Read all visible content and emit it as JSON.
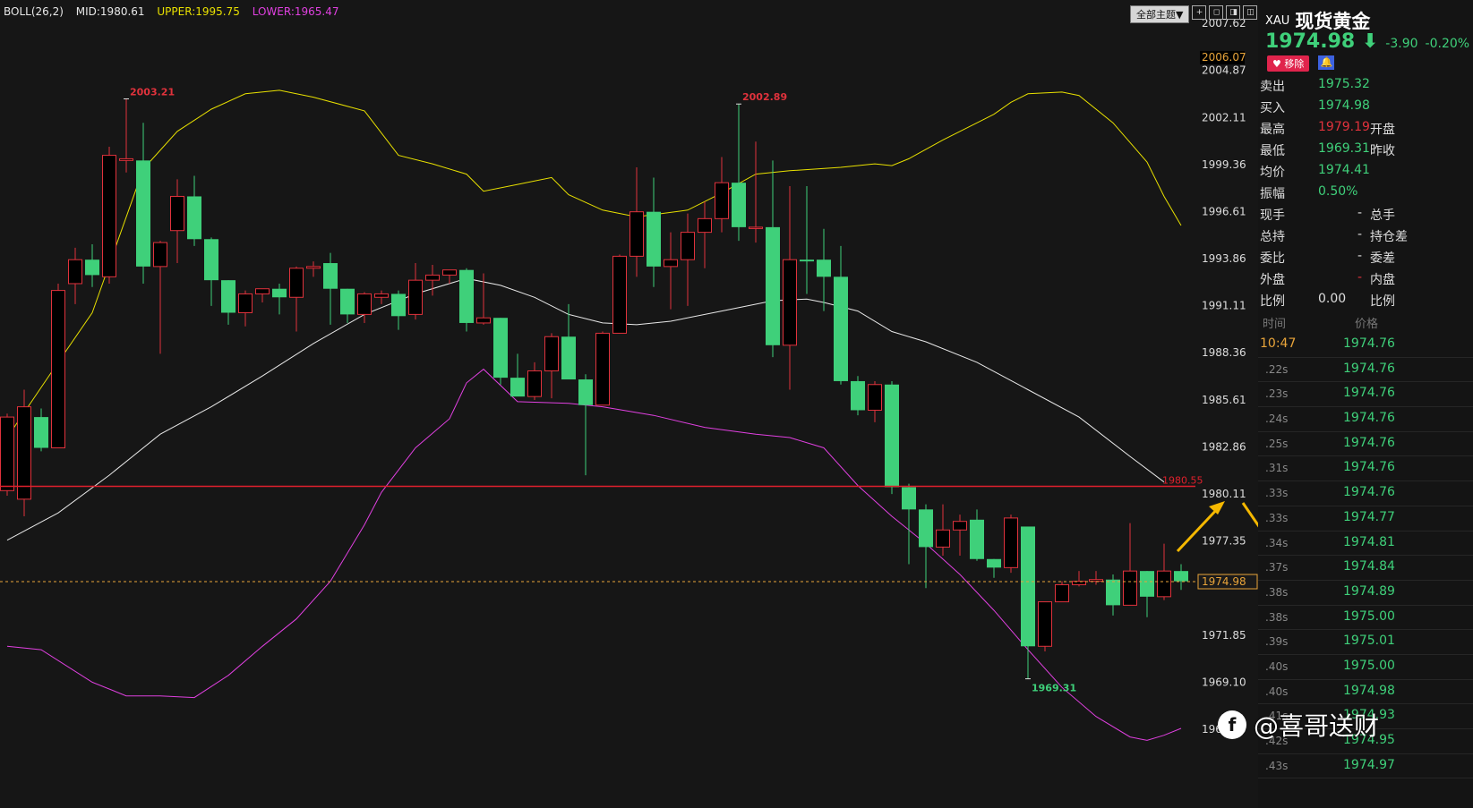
{
  "indicator": {
    "name": "BOLL(26,2)",
    "mid": "MID:1980.61",
    "upper": "UPPER:1995.75",
    "lower": "LOWER:1965.47",
    "colors": {
      "mid": "#e8e8e8",
      "upper": "#e8e000",
      "lower": "#e040e0"
    }
  },
  "toolbar": {
    "theme_label": "全部主题▼",
    "buttons": [
      "+",
      "◻",
      "◨",
      "◫"
    ]
  },
  "chart_data": {
    "type": "candlestick",
    "y_axis_labels": [
      "2007.62",
      "2004.87",
      "2002.11",
      "1999.36",
      "1996.61",
      "1993.86",
      "1991.11",
      "1988.36",
      "1985.61",
      "1982.86",
      "1980.11",
      "1977.35",
      "1971.85",
      "1969.10",
      "1966.35"
    ],
    "ylim": [
      1965.0,
      2008.9
    ],
    "high_label": "2006.07",
    "annotations": {
      "high1": "2003.21",
      "high2": "2002.89",
      "low": "1969.31"
    },
    "alert_line": {
      "value": 1980.55,
      "label": "1980.55",
      "color": "#e0202c"
    },
    "last_price": {
      "value": 1974.98,
      "label": "1974.98",
      "color": "#e8a43a"
    },
    "up_color": "#e0323c",
    "down_color": "#3fd07a",
    "candles": [
      {
        "o": 1980.3,
        "h": 1984.8,
        "l": 1980.0,
        "c": 1984.6
      },
      {
        "o": 1979.8,
        "h": 1986.2,
        "l": 1978.8,
        "c": 1985.2
      },
      {
        "o": 1984.6,
        "h": 1985.1,
        "l": 1982.6,
        "c": 1982.8
      },
      {
        "o": 1982.8,
        "h": 1992.4,
        "l": 1983.4,
        "c": 1992.0
      },
      {
        "o": 1992.4,
        "h": 1994.5,
        "l": 1991.2,
        "c": 1993.8
      },
      {
        "o": 1993.8,
        "h": 1994.7,
        "l": 1992.2,
        "c": 1992.9
      },
      {
        "o": 1992.8,
        "h": 2000.4,
        "l": 1992.4,
        "c": 1999.9
      },
      {
        "o": 1999.6,
        "h": 2003.2,
        "l": 1998.9,
        "c": 1999.7
      },
      {
        "o": 1999.6,
        "h": 2001.8,
        "l": 1992.4,
        "c": 1993.4
      },
      {
        "o": 1993.4,
        "h": 1994.9,
        "l": 1988.3,
        "c": 1994.8
      },
      {
        "o": 1995.5,
        "h": 1998.5,
        "l": 1993.6,
        "c": 1997.5
      },
      {
        "o": 1997.5,
        "h": 1998.7,
        "l": 1994.6,
        "c": 1995.0
      },
      {
        "o": 1995.0,
        "h": 1995.1,
        "l": 1991.1,
        "c": 1992.6
      },
      {
        "o": 1992.6,
        "h": 1992.6,
        "l": 1990.0,
        "c": 1990.7
      },
      {
        "o": 1990.7,
        "h": 1992.0,
        "l": 1989.9,
        "c": 1991.8
      },
      {
        "o": 1991.8,
        "h": 1992.1,
        "l": 1991.3,
        "c": 1992.1
      },
      {
        "o": 1992.1,
        "h": 1992.4,
        "l": 1990.6,
        "c": 1991.6
      },
      {
        "o": 1991.6,
        "h": 1993.4,
        "l": 1989.6,
        "c": 1993.3
      },
      {
        "o": 1993.3,
        "h": 1993.7,
        "l": 1992.8,
        "c": 1993.4
      },
      {
        "o": 1993.6,
        "h": 1994.2,
        "l": 1990.0,
        "c": 1992.1
      },
      {
        "o": 1992.1,
        "h": 1992.1,
        "l": 1990.1,
        "c": 1990.6
      },
      {
        "o": 1990.6,
        "h": 1991.9,
        "l": 1990.1,
        "c": 1991.8
      },
      {
        "o": 1991.6,
        "h": 1992.0,
        "l": 1991.2,
        "c": 1991.8
      },
      {
        "o": 1991.8,
        "h": 1992.0,
        "l": 1989.7,
        "c": 1990.5
      },
      {
        "o": 1990.6,
        "h": 1993.6,
        "l": 1990.3,
        "c": 1992.6
      },
      {
        "o": 1992.6,
        "h": 1993.5,
        "l": 1991.7,
        "c": 1992.9
      },
      {
        "o": 1992.9,
        "h": 1993.2,
        "l": 1992.4,
        "c": 1993.2
      },
      {
        "o": 1993.2,
        "h": 1993.3,
        "l": 1989.6,
        "c": 1990.1
      },
      {
        "o": 1990.1,
        "h": 1993.0,
        "l": 1990.0,
        "c": 1990.4
      },
      {
        "o": 1990.4,
        "h": 1990.4,
        "l": 1986.5,
        "c": 1986.9
      },
      {
        "o": 1986.9,
        "h": 1988.3,
        "l": 1985.9,
        "c": 1985.8
      },
      {
        "o": 1985.8,
        "h": 1987.8,
        "l": 1985.6,
        "c": 1987.3
      },
      {
        "o": 1987.3,
        "h": 1989.5,
        "l": 1985.7,
        "c": 1989.3
      },
      {
        "o": 1989.3,
        "h": 1991.2,
        "l": 1986.8,
        "c": 1986.8
      },
      {
        "o": 1986.8,
        "h": 1987.1,
        "l": 1981.2,
        "c": 1985.3
      },
      {
        "o": 1985.3,
        "h": 1989.6,
        "l": 1985.4,
        "c": 1989.5
      },
      {
        "o": 1989.5,
        "h": 1994.1,
        "l": 1989.6,
        "c": 1994.0
      },
      {
        "o": 1994.0,
        "h": 1999.2,
        "l": 1992.8,
        "c": 1996.6
      },
      {
        "o": 1996.6,
        "h": 1998.6,
        "l": 1992.2,
        "c": 1993.4
      },
      {
        "o": 1993.4,
        "h": 1995.4,
        "l": 1990.9,
        "c": 1993.8
      },
      {
        "o": 1993.8,
        "h": 1996.5,
        "l": 1991.1,
        "c": 1995.4
      },
      {
        "o": 1995.4,
        "h": 1997.2,
        "l": 1993.3,
        "c": 1996.2
      },
      {
        "o": 1996.2,
        "h": 1999.8,
        "l": 1995.4,
        "c": 1998.3
      },
      {
        "o": 1998.3,
        "h": 2002.9,
        "l": 1994.9,
        "c": 1995.7
      },
      {
        "o": 1995.7,
        "h": 2000.7,
        "l": 1994.8,
        "c": 1995.7
      },
      {
        "o": 1995.7,
        "h": 1999.6,
        "l": 1988.1,
        "c": 1988.8
      },
      {
        "o": 1988.8,
        "h": 1998.1,
        "l": 1986.2,
        "c": 1993.8
      },
      {
        "o": 1993.8,
        "h": 1998.1,
        "l": 1991.8,
        "c": 1993.7
      },
      {
        "o": 1993.8,
        "h": 1995.6,
        "l": 1990.8,
        "c": 1992.8
      },
      {
        "o": 1992.8,
        "h": 1994.6,
        "l": 1986.5,
        "c": 1986.7
      },
      {
        "o": 1986.7,
        "h": 1987.0,
        "l": 1984.7,
        "c": 1985.0
      },
      {
        "o": 1985.0,
        "h": 1986.7,
        "l": 1984.3,
        "c": 1986.5
      },
      {
        "o": 1986.5,
        "h": 1986.7,
        "l": 1980.1,
        "c": 1980.5
      },
      {
        "o": 1980.5,
        "h": 1980.7,
        "l": 1976.0,
        "c": 1979.2
      },
      {
        "o": 1979.2,
        "h": 1979.5,
        "l": 1974.6,
        "c": 1977.0
      },
      {
        "o": 1977.0,
        "h": 1979.5,
        "l": 1976.5,
        "c": 1978.0
      },
      {
        "o": 1978.0,
        "h": 1978.9,
        "l": 1976.5,
        "c": 1978.5
      },
      {
        "o": 1978.6,
        "h": 1979.2,
        "l": 1976.2,
        "c": 1976.3
      },
      {
        "o": 1976.3,
        "h": 1976.3,
        "l": 1975.2,
        "c": 1975.8
      },
      {
        "o": 1975.8,
        "h": 1978.9,
        "l": 1975.5,
        "c": 1978.7
      },
      {
        "o": 1978.2,
        "h": 1978.2,
        "l": 1969.3,
        "c": 1971.2
      },
      {
        "o": 1971.2,
        "h": 1973.8,
        "l": 1970.9,
        "c": 1973.8
      },
      {
        "o": 1973.8,
        "h": 1975.0,
        "l": 1973.8,
        "c": 1974.8
      },
      {
        "o": 1974.8,
        "h": 1975.6,
        "l": 1974.7,
        "c": 1975.0
      },
      {
        "o": 1975.0,
        "h": 1975.6,
        "l": 1974.8,
        "c": 1975.1
      },
      {
        "o": 1975.1,
        "h": 1975.4,
        "l": 1973.0,
        "c": 1973.6
      },
      {
        "o": 1973.6,
        "h": 1978.4,
        "l": 1973.6,
        "c": 1975.6
      },
      {
        "o": 1975.6,
        "h": 1975.6,
        "l": 1972.9,
        "c": 1974.1
      },
      {
        "o": 1974.1,
        "h": 1977.2,
        "l": 1973.9,
        "c": 1975.6
      },
      {
        "o": 1975.6,
        "h": 1976.0,
        "l": 1974.5,
        "c": 1975.0
      }
    ],
    "boll_upper": [
      [
        0,
        1983.4
      ],
      [
        3,
        1987.8
      ],
      [
        5,
        1990.7
      ],
      [
        8,
        1999.1
      ],
      [
        10,
        2001.3
      ],
      [
        12,
        2002.6
      ],
      [
        14,
        2003.5
      ],
      [
        16,
        2003.7
      ],
      [
        18,
        2003.3
      ],
      [
        21,
        2002.5
      ],
      [
        23,
        1999.9
      ],
      [
        25,
        1999.4
      ],
      [
        27,
        1998.8
      ],
      [
        28,
        1997.8
      ],
      [
        30,
        1998.2
      ],
      [
        32,
        1998.6
      ],
      [
        33,
        1997.6
      ],
      [
        35,
        1996.7
      ],
      [
        37,
        1996.3
      ],
      [
        40,
        1996.7
      ],
      [
        42,
        1997.7
      ],
      [
        44,
        1998.8
      ],
      [
        46,
        1999.0
      ],
      [
        49,
        1999.2
      ],
      [
        51,
        1999.4
      ],
      [
        52,
        1999.3
      ],
      [
        53,
        1999.7
      ],
      [
        55,
        2000.8
      ],
      [
        57,
        2001.8
      ],
      [
        58,
        2002.3
      ],
      [
        59,
        2003.0
      ],
      [
        60,
        2003.5
      ],
      [
        62,
        2003.6
      ],
      [
        63,
        2003.4
      ],
      [
        65,
        2001.8
      ],
      [
        67,
        1999.5
      ],
      [
        68,
        1997.5
      ],
      [
        69,
        1995.8
      ]
    ],
    "boll_mid": [
      [
        0,
        1977.4
      ],
      [
        3,
        1979.0
      ],
      [
        6,
        1981.2
      ],
      [
        9,
        1983.6
      ],
      [
        12,
        1985.2
      ],
      [
        15,
        1987.0
      ],
      [
        18,
        1988.9
      ],
      [
        21,
        1990.6
      ],
      [
        24,
        1991.8
      ],
      [
        27,
        1992.7
      ],
      [
        29,
        1992.3
      ],
      [
        31,
        1991.6
      ],
      [
        33,
        1990.6
      ],
      [
        35,
        1990.1
      ],
      [
        37,
        1990.0
      ],
      [
        39,
        1990.2
      ],
      [
        42,
        1990.8
      ],
      [
        45,
        1991.4
      ],
      [
        47,
        1991.5
      ],
      [
        48,
        1991.3
      ],
      [
        50,
        1990.8
      ],
      [
        52,
        1989.6
      ],
      [
        54,
        1989.0
      ],
      [
        57,
        1987.8
      ],
      [
        60,
        1986.2
      ],
      [
        63,
        1984.6
      ],
      [
        66,
        1982.3
      ],
      [
        68,
        1980.8
      ]
    ],
    "boll_lower": [
      [
        0,
        1971.2
      ],
      [
        2,
        1971.0
      ],
      [
        5,
        1969.1
      ],
      [
        7,
        1968.3
      ],
      [
        9,
        1968.3
      ],
      [
        11,
        1968.2
      ],
      [
        13,
        1969.5
      ],
      [
        15,
        1971.2
      ],
      [
        17,
        1972.8
      ],
      [
        19,
        1975.0
      ],
      [
        21,
        1978.3
      ],
      [
        22,
        1980.2
      ],
      [
        24,
        1982.8
      ],
      [
        26,
        1984.5
      ],
      [
        27,
        1986.6
      ],
      [
        28,
        1987.4
      ],
      [
        30,
        1985.5
      ],
      [
        33,
        1985.4
      ],
      [
        35,
        1985.2
      ],
      [
        38,
        1984.7
      ],
      [
        41,
        1984.0
      ],
      [
        44,
        1983.6
      ],
      [
        46,
        1983.4
      ],
      [
        48,
        1982.8
      ],
      [
        50,
        1980.6
      ],
      [
        52,
        1978.8
      ],
      [
        54,
        1977.2
      ],
      [
        56,
        1975.4
      ],
      [
        58,
        1973.3
      ],
      [
        60,
        1971.0
      ],
      [
        62,
        1968.8
      ],
      [
        64,
        1967.1
      ],
      [
        66,
        1965.9
      ],
      [
        67,
        1965.7
      ],
      [
        68,
        1966.0
      ],
      [
        69,
        1966.4
      ]
    ]
  },
  "panel": {
    "symbol_code": "XAU",
    "symbol_name": "现货黄金",
    "price": "1974.98 ⬇",
    "change": "-3.90",
    "change_pct": "-0.20%",
    "remove_label": "♥ 移除",
    "bell": "🔔",
    "quotes": [
      {
        "label": "卖出",
        "value": "1975.32",
        "vclass": "",
        "dash": "",
        "label2": ""
      },
      {
        "label": "买入",
        "value": "1974.98",
        "vclass": "",
        "dash": "",
        "label2": ""
      },
      {
        "label": "最高",
        "value": "1979.19",
        "vclass": "red",
        "dash": "",
        "label2": "开盘"
      },
      {
        "label": "最低",
        "value": "1969.31",
        "vclass": "",
        "dash": "",
        "label2": "昨收"
      },
      {
        "label": "均价",
        "value": "1974.41",
        "vclass": "",
        "dash": "",
        "label2": ""
      },
      {
        "label": "振幅",
        "value": "0.50%",
        "vclass": "",
        "dash": "",
        "label2": ""
      },
      {
        "label": "现手",
        "value": "",
        "vclass": "",
        "dash": "-",
        "label2": "总手"
      },
      {
        "label": "总持",
        "value": "",
        "vclass": "",
        "dash": "-",
        "label2": "持仓差"
      },
      {
        "label": "委比",
        "value": "",
        "vclass": "",
        "dash": "-",
        "label2": "委差"
      },
      {
        "label": "外盘",
        "value": "",
        "vclass": "",
        "dash": "-",
        "label2": "内盘"
      },
      {
        "label": "比例",
        "value": "0.00",
        "vclass": "plain",
        "dash": "",
        "label2": "比例"
      }
    ],
    "tick_header": {
      "time": "时间",
      "price": "价格"
    },
    "ticks": [
      {
        "time": "10:47",
        "price": "1974.76"
      },
      {
        "time": ".22s",
        "price": "1974.76"
      },
      {
        "time": ".23s",
        "price": "1974.76"
      },
      {
        "time": ".24s",
        "price": "1974.76"
      },
      {
        "time": ".25s",
        "price": "1974.76"
      },
      {
        "time": ".31s",
        "price": "1974.76"
      },
      {
        "time": ".33s",
        "price": "1974.76"
      },
      {
        "time": ".33s",
        "price": "1974.77"
      },
      {
        "time": ".34s",
        "price": "1974.81"
      },
      {
        "time": ".37s",
        "price": "1974.84"
      },
      {
        "time": ".38s",
        "price": "1974.89"
      },
      {
        "time": ".38s",
        "price": "1975.00"
      },
      {
        "time": ".39s",
        "price": "1975.01"
      },
      {
        "time": ".40s",
        "price": "1975.00"
      },
      {
        "time": ".40s",
        "price": "1974.98"
      },
      {
        "time": ".41s",
        "price": "1974.93"
      },
      {
        "time": ".42s",
        "price": "1974.95"
      },
      {
        "time": ".43s",
        "price": "1974.97"
      }
    ]
  },
  "watermark": {
    "logo": "f",
    "text": "@喜哥送财"
  }
}
